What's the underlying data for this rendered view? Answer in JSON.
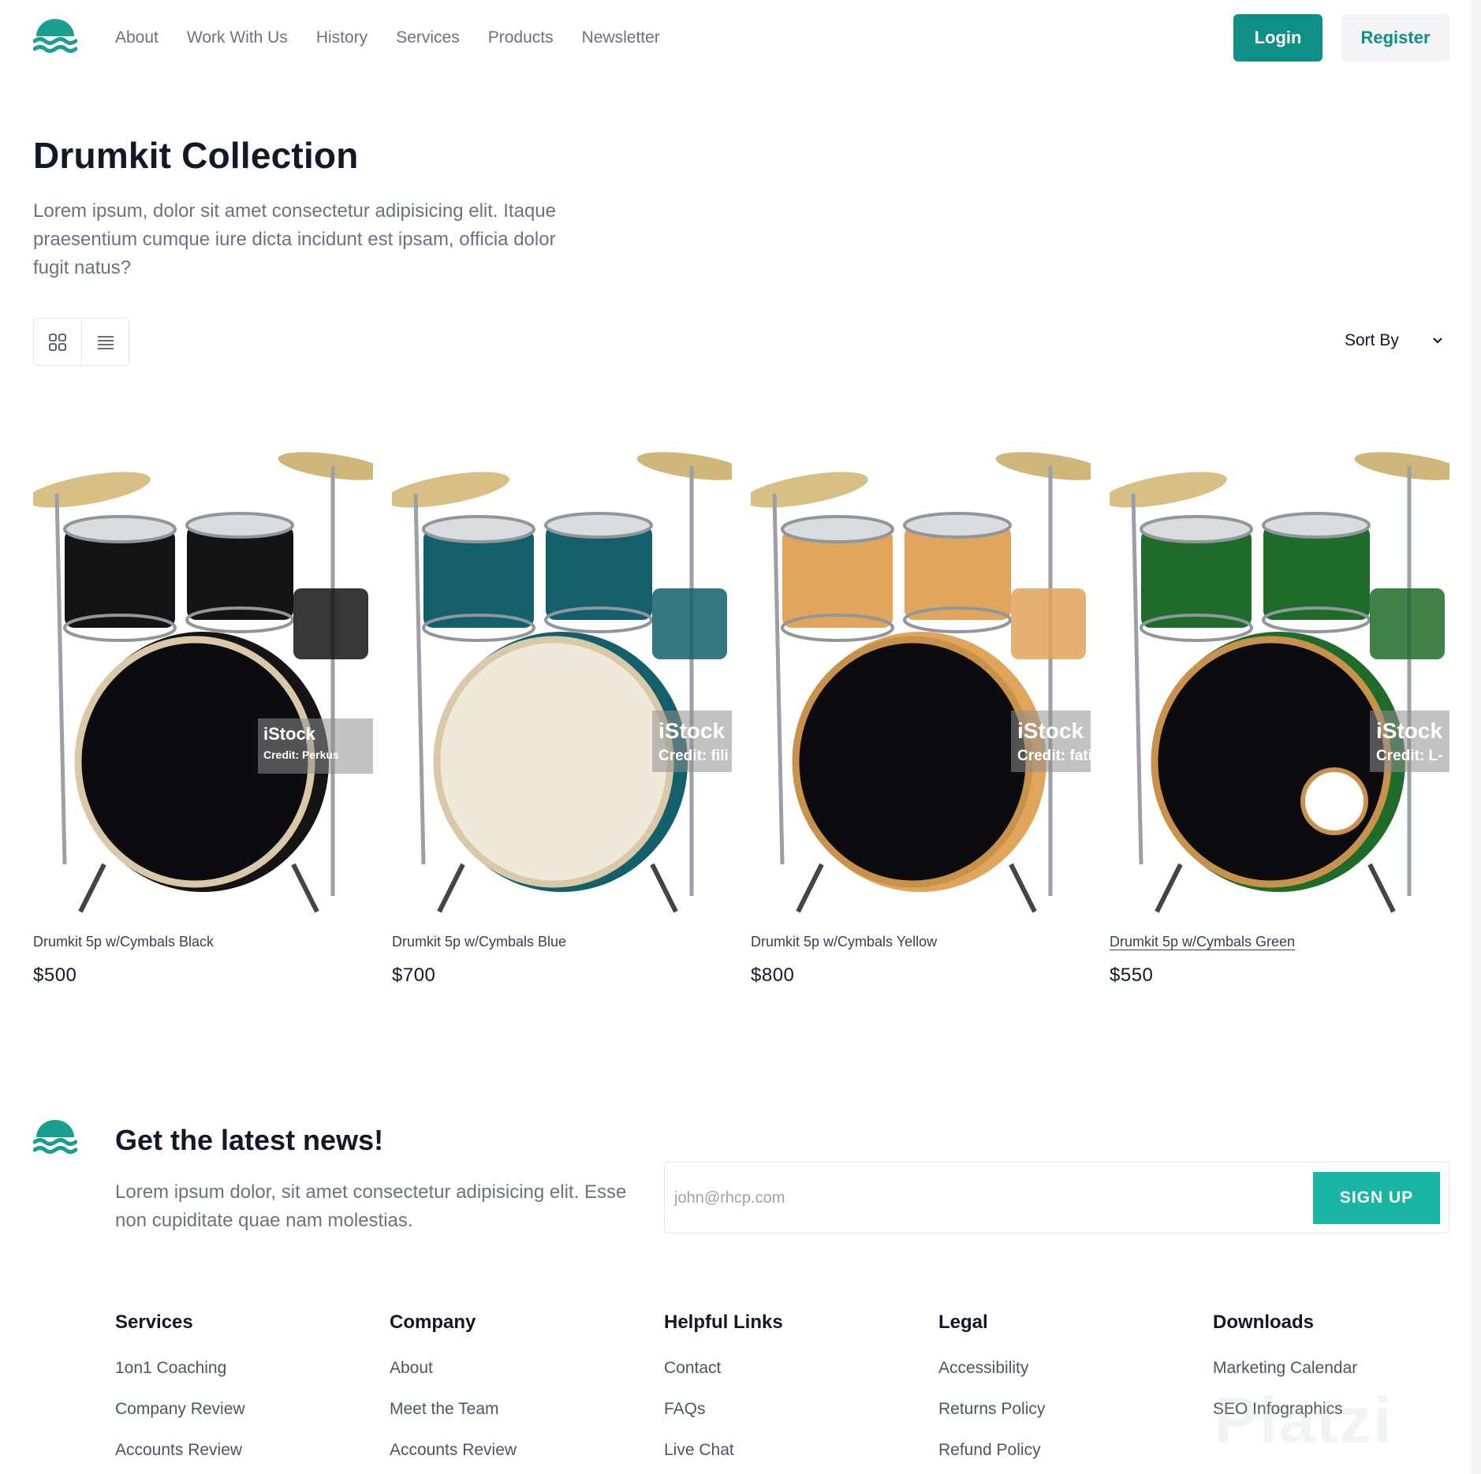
{
  "brand": {
    "accent": "#0f8f85",
    "signup_color": "#1ab5a3"
  },
  "header": {
    "nav": [
      "About",
      "Work With Us",
      "History",
      "Services",
      "Products",
      "Newsletter"
    ],
    "login_label": "Login",
    "register_label": "Register"
  },
  "hero": {
    "title": "Drumkit Collection",
    "description": "Lorem ipsum, dolor sit amet consectetur adipisicing elit. Itaque praesentium cumque iure dicta incidunt est ipsam, officia dolor fugit natus?"
  },
  "toolbar": {
    "grid_icon": "grid-icon",
    "list_icon": "list-icon",
    "sort_label": "Sort By"
  },
  "products": [
    {
      "name": "Drumkit 5p w/Cymbals Black",
      "price": "$500",
      "color": "#141414",
      "watermark": "iStock",
      "credit": "Credit: Perkus"
    },
    {
      "name": "Drumkit 5p w/Cymbals Blue",
      "price": "$700",
      "color": "#135f6b",
      "watermark": "iStock",
      "credit": "Credit: fili"
    },
    {
      "name": "Drumkit 5p w/Cymbals Yellow",
      "price": "$800",
      "color": "#e0a55a",
      "watermark": "iStock",
      "credit": "Credit: fatih"
    },
    {
      "name": "Drumkit 5p w/Cymbals Green",
      "price": "$550",
      "color": "#1f6b2a",
      "watermark": "iStock",
      "credit": "Credit: L-"
    }
  ],
  "newsletter": {
    "title": "Get the latest news!",
    "description": "Lorem ipsum dolor, sit amet consectetur adipisicing elit. Esse non cupiditate quae nam molestias.",
    "email_placeholder": "john@rhcp.com",
    "signup_label": "SIGN UP"
  },
  "footer": [
    {
      "heading": "Services",
      "links": [
        "1on1 Coaching",
        "Company Review",
        "Accounts Review"
      ]
    },
    {
      "heading": "Company",
      "links": [
        "About",
        "Meet the Team",
        "Accounts Review"
      ]
    },
    {
      "heading": "Helpful Links",
      "links": [
        "Contact",
        "FAQs",
        "Live Chat"
      ]
    },
    {
      "heading": "Legal",
      "links": [
        "Accessibility",
        "Returns Policy",
        "Refund Policy"
      ]
    },
    {
      "heading": "Downloads",
      "links": [
        "Marketing Calendar",
        "SEO Infographics"
      ]
    }
  ],
  "watermark_text": "Platzi"
}
